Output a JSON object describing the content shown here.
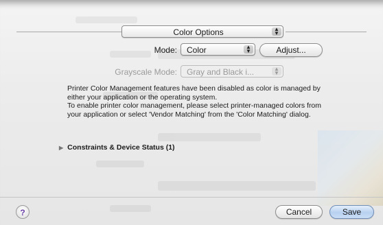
{
  "panel_menu": {
    "selected": "Color Options"
  },
  "mode": {
    "label": "Mode:",
    "selected": "Color"
  },
  "adjust_button": "Adjust...",
  "grayscale": {
    "label": "Grayscale Mode:",
    "selected": "Gray and Black i..."
  },
  "info": {
    "line1": "Printer Color Management features have been disabled as color is managed by either your application or the operating system.",
    "line2": "To enable printer color management, please select printer-managed colors from your application or select 'Vendor Matching' from the 'Color Matching' dialog."
  },
  "disclosure": {
    "label": "Constraints & Device Status (1)"
  },
  "footer": {
    "help": "?",
    "cancel": "Cancel",
    "save": "Save"
  },
  "icons": {
    "arrows": "updown-arrows-icon",
    "disclosure": "disclosure-triangle-icon",
    "help": "help-icon"
  }
}
